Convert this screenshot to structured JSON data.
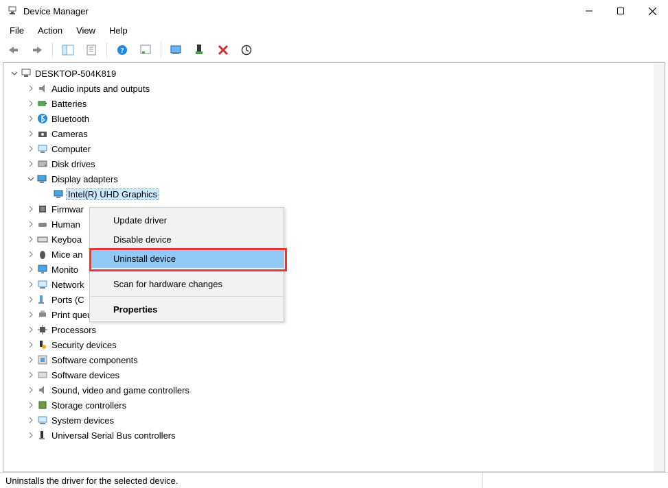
{
  "window": {
    "title": "Device Manager"
  },
  "menu": {
    "file": "File",
    "action": "Action",
    "view": "View",
    "help": "Help"
  },
  "root": {
    "label": "DESKTOP-504K819"
  },
  "categories": {
    "audio": "Audio inputs and outputs",
    "batteries": "Batteries",
    "bluetooth": "Bluetooth",
    "cameras": "Cameras",
    "computer": "Computer",
    "disk": "Disk drives",
    "display": "Display adapters",
    "display_child": "Intel(R) UHD Graphics",
    "firmware": "Firmwar",
    "hid": "Human ",
    "keyboards": "Keyboa",
    "mice": "Mice an",
    "monitors": "Monito",
    "network": "Network",
    "ports": "Ports (C",
    "printq": "Print queues",
    "processors": "Processors",
    "security": "Security devices",
    "swcomp": "Software components",
    "swdev": "Software devices",
    "sound": "Sound, video and game controllers",
    "storage": "Storage controllers",
    "system": "System devices",
    "usb": "Universal Serial Bus controllers"
  },
  "context_menu": {
    "update": "Update driver",
    "disable": "Disable device",
    "uninstall": "Uninstall device",
    "scan": "Scan for hardware changes",
    "properties": "Properties"
  },
  "status": {
    "text": "Uninstalls the driver for the selected device."
  }
}
